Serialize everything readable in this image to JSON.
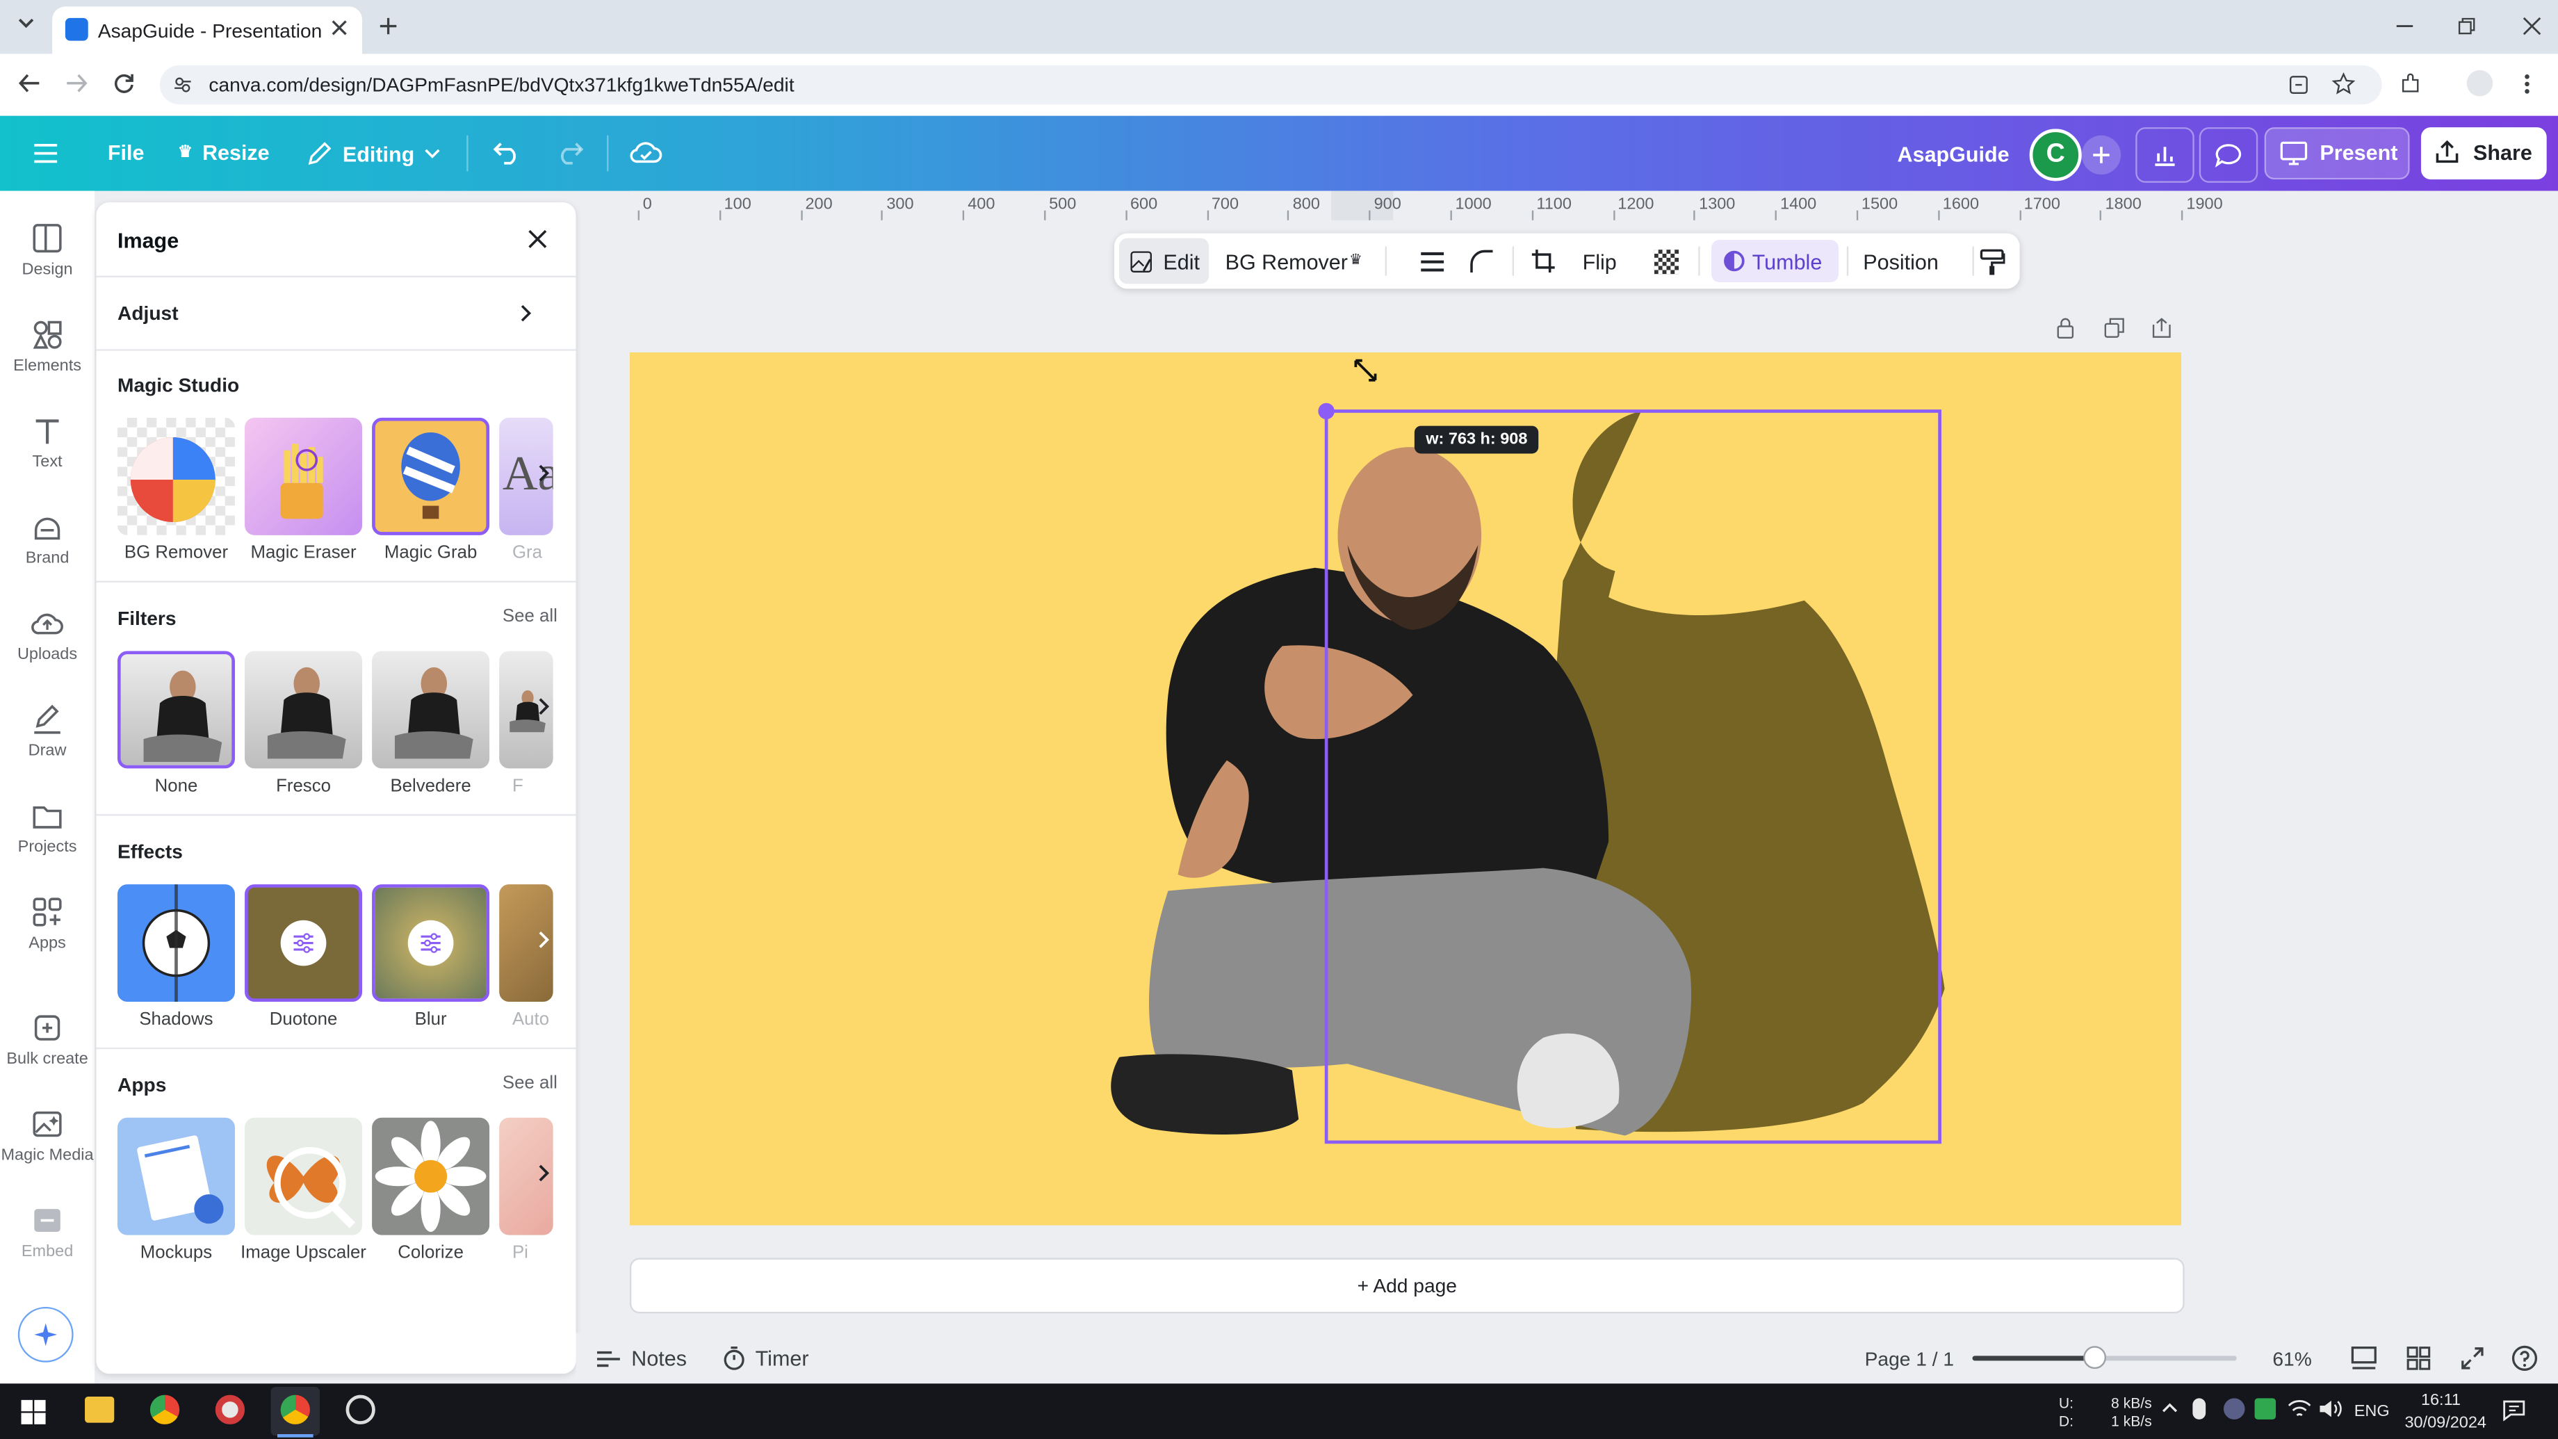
{
  "browser": {
    "tab_title": "AsapGuide - Presentation",
    "url": "canva.com/design/DAGPmFasnPE/bdVQtx371kfg1kweTdn55A/edit"
  },
  "header": {
    "file": "File",
    "resize": "Resize",
    "editing": "Editing",
    "team_name": "AsapGuide",
    "avatar_letter": "C",
    "present": "Present",
    "share": "Share"
  },
  "rail": [
    {
      "label": "Design",
      "icon": "design-icon"
    },
    {
      "label": "Elements",
      "icon": "elements-icon"
    },
    {
      "label": "Text",
      "icon": "text-icon"
    },
    {
      "label": "Brand",
      "icon": "brand-icon"
    },
    {
      "label": "Uploads",
      "icon": "uploads-icon"
    },
    {
      "label": "Draw",
      "icon": "draw-icon"
    },
    {
      "label": "Projects",
      "icon": "projects-icon"
    },
    {
      "label": "Apps",
      "icon": "apps-icon"
    },
    {
      "label": "Bulk create",
      "icon": "bulk-create-icon"
    },
    {
      "label": "Magic Media",
      "icon": "magic-media-icon"
    },
    {
      "label": "Embed",
      "icon": "embed-icon"
    }
  ],
  "panel": {
    "title": "Image",
    "adjust": "Adjust",
    "magic_studio": {
      "title": "Magic Studio",
      "items": [
        "BG Remover",
        "Magic Eraser",
        "Magic Grab",
        "Gra"
      ]
    },
    "filters": {
      "title": "Filters",
      "see_all": "See all",
      "items": [
        "None",
        "Fresco",
        "Belvedere",
        "F"
      ]
    },
    "effects": {
      "title": "Effects",
      "items": [
        "Shadows",
        "Duotone",
        "Blur",
        "Auto"
      ]
    },
    "apps": {
      "title": "Apps",
      "see_all": "See all",
      "items": [
        "Mockups",
        "Image Upscaler",
        "Colorize",
        "Pi"
      ]
    }
  },
  "ruler": [
    "0",
    "100",
    "200",
    "300",
    "400",
    "500",
    "600",
    "700",
    "800",
    "900",
    "1000",
    "1100",
    "1200",
    "1300",
    "1400",
    "1500",
    "1600",
    "1700",
    "1800",
    "1900"
  ],
  "toolbar": {
    "edit": "Edit",
    "bg_remover": "BG Remover",
    "flip": "Flip",
    "tumble": "Tumble",
    "position": "Position"
  },
  "canvas": {
    "size_tooltip": "w: 763 h: 908",
    "add_page": "+ Add page",
    "page_color": "#fcd96a",
    "selection_color": "#8b5cf6"
  },
  "footer": {
    "notes": "Notes",
    "timer": "Timer",
    "page": "Page 1 / 1",
    "zoom": "61%",
    "zoom_level": 0.61
  },
  "taskbar": {
    "network_up": "U:",
    "network_down": "D:",
    "up_rate": "8 kB/s",
    "down_rate": "1 kB/s",
    "lang": "ENG",
    "time": "16:11",
    "date": "30/09/2024"
  }
}
